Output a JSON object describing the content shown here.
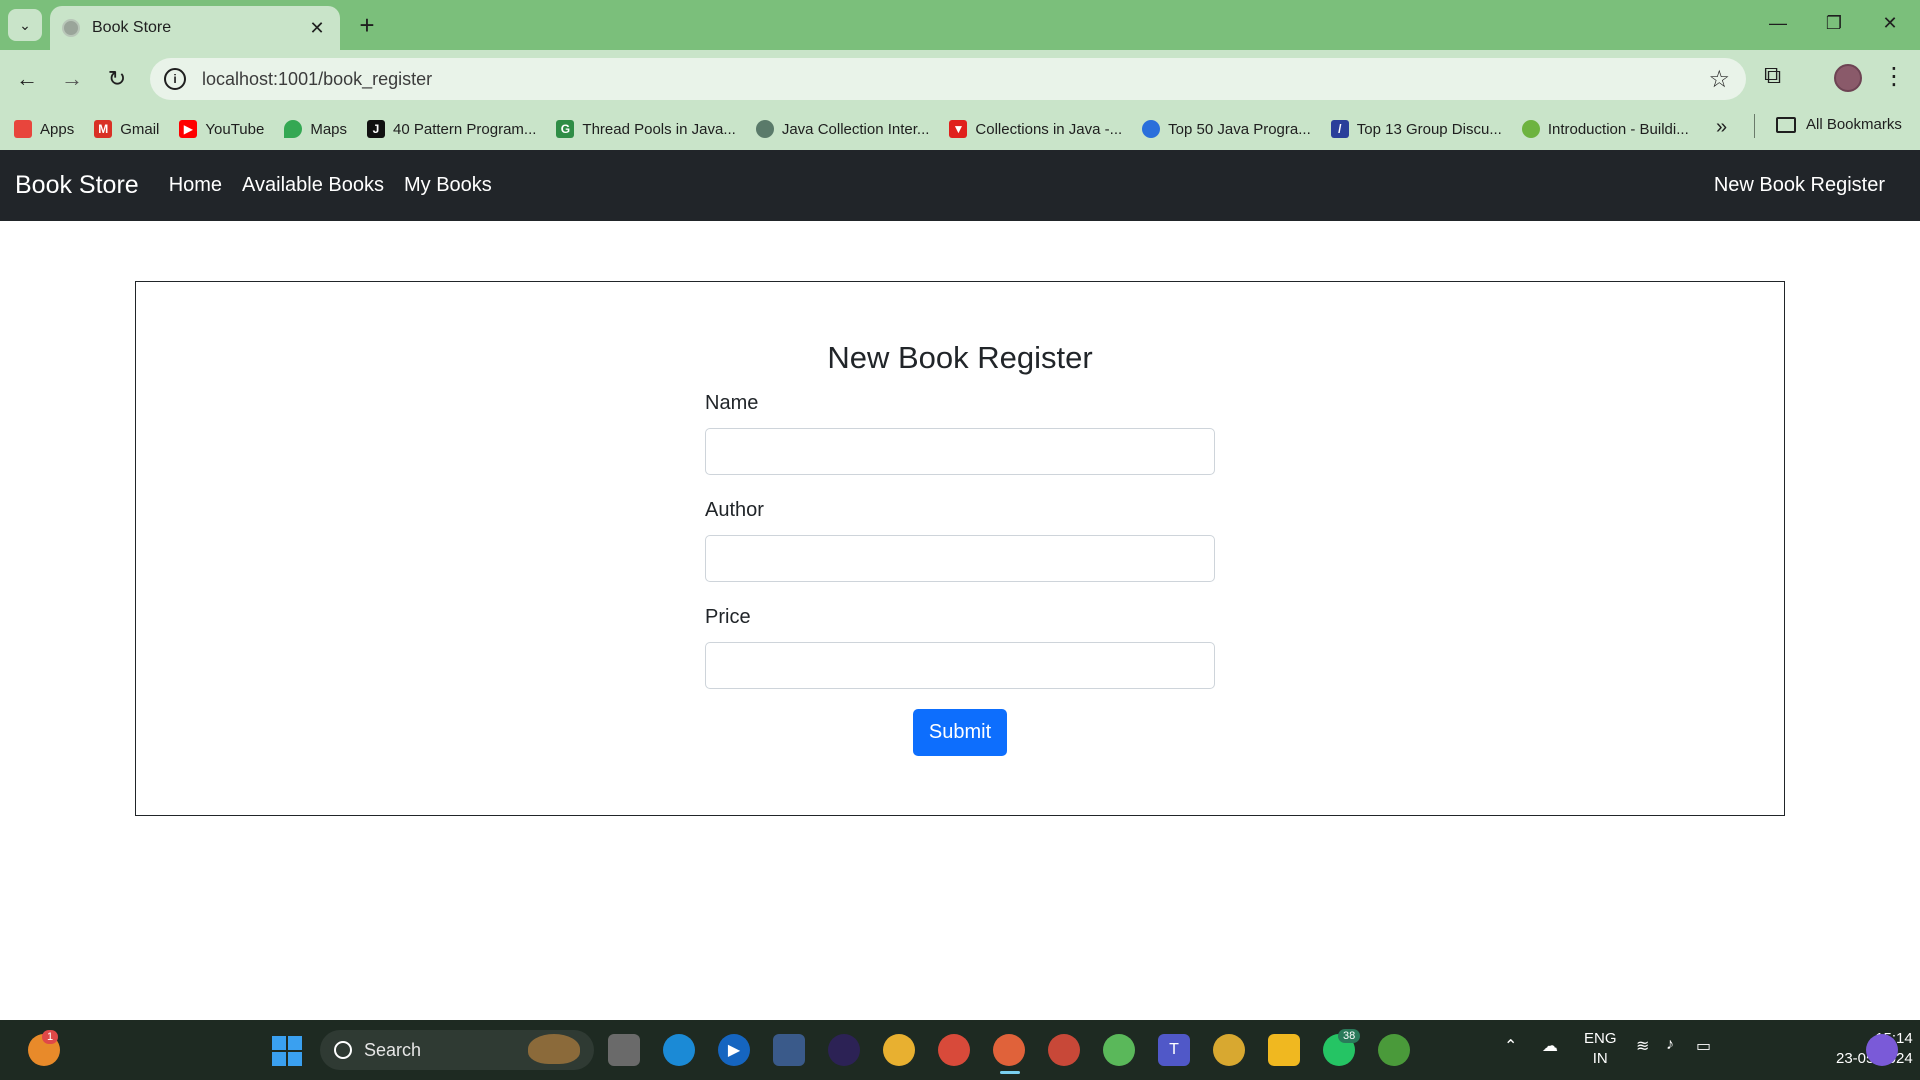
{
  "browser": {
    "tab_title": "Book Store",
    "new_tab": "+",
    "url": "localhost:1001/book_register",
    "minimize": "—",
    "restore": "❐",
    "close": "✕"
  },
  "bookmarks": [
    {
      "label": "Apps",
      "icon": "apps-grid-icon",
      "color": "#e8453c"
    },
    {
      "label": "Gmail",
      "icon": "gmail-icon",
      "color": "#d93025"
    },
    {
      "label": "YouTube",
      "icon": "youtube-icon",
      "color": "#ff0000"
    },
    {
      "label": "Maps",
      "icon": "maps-icon",
      "color": "#34a853"
    },
    {
      "label": "40 Pattern Program...",
      "icon": "j-icon",
      "color": "#111111"
    },
    {
      "label": "Thread Pools in Java...",
      "icon": "geeksforgeeks-icon",
      "color": "#2f8d46"
    },
    {
      "label": "Java Collection Inter...",
      "icon": "openai-icon",
      "color": "#5a7a6a"
    },
    {
      "label": "Collections in Java -...",
      "icon": "javatpoint-icon",
      "color": "#e0201c"
    },
    {
      "label": "Top 50 Java Progra...",
      "icon": "interviewbit-icon",
      "color": "#2a6fdb"
    },
    {
      "label": "Top 13 Group Discu...",
      "icon": "article-icon",
      "color": "#2a3f9a"
    },
    {
      "label": "Introduction - Buildi...",
      "icon": "spring-icon",
      "color": "#6db33f"
    }
  ],
  "bookmarks_more": "»",
  "all_bookmarks": "All Bookmarks",
  "navbar": {
    "brand": "Book Store",
    "links": [
      "Home",
      "Available Books",
      "My Books"
    ],
    "right_link": "New Book Register"
  },
  "form": {
    "title": "New Book Register",
    "fields": [
      {
        "label": "Name",
        "value": ""
      },
      {
        "label": "Author",
        "value": ""
      },
      {
        "label": "Price",
        "value": ""
      }
    ],
    "submit_label": "Submit"
  },
  "taskbar": {
    "search_label": "Search",
    "notification_badge": "1",
    "whatsapp_badge": "38",
    "lang_line1": "ENG",
    "lang_line2": "IN",
    "time": "15:14",
    "date": "23-05-2024"
  },
  "colors": {
    "tab_strip": "#7bbf7b",
    "toolbar": "#c9e4c9",
    "navbar": "#212529",
    "primary_button": "#0d6efd"
  }
}
